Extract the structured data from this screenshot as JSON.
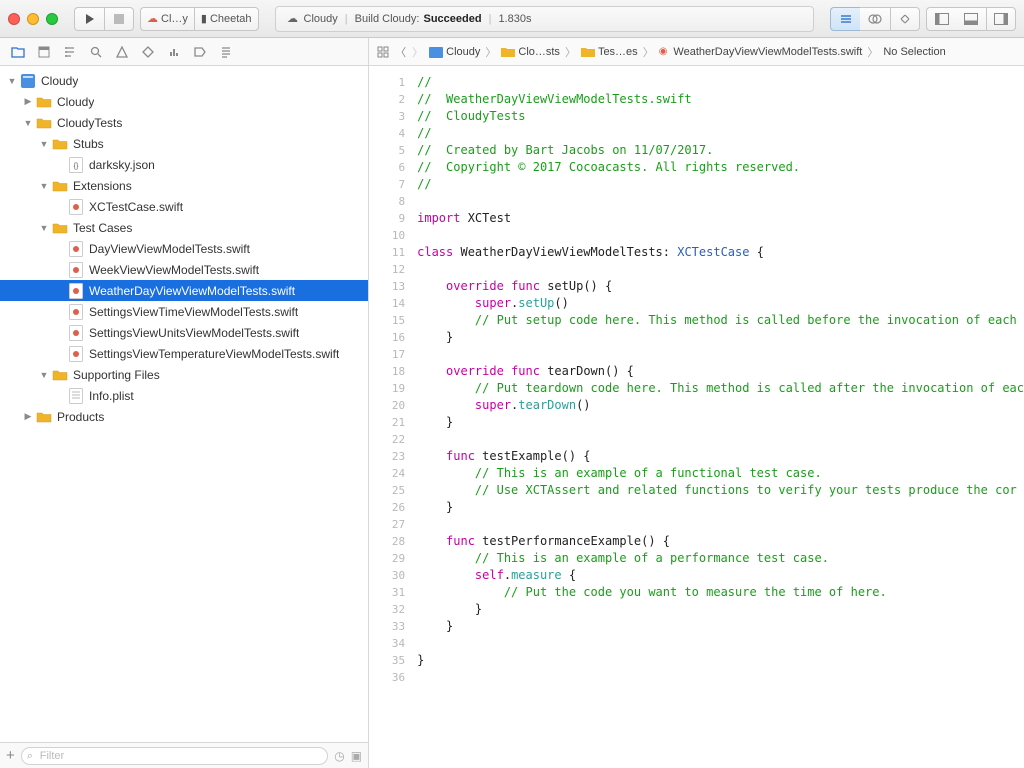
{
  "toolbar": {
    "scheme": "Cl…y",
    "device": "Cheetah",
    "status_app": "Cloudy",
    "status_action": "Build Cloudy:",
    "status_result": "Succeeded",
    "status_time": "1.830s"
  },
  "jumpbar": {
    "crumb1": "Cloudy",
    "crumb2": "Clo…sts",
    "crumb3": "Tes…es",
    "crumb4": "WeatherDayViewViewModelTests.swift",
    "crumb5": "No Selection"
  },
  "tree": [
    {
      "d": 0,
      "disc": "down",
      "icon": "proj",
      "label": "Cloudy"
    },
    {
      "d": 1,
      "disc": "right",
      "icon": "folder",
      "label": "Cloudy"
    },
    {
      "d": 1,
      "disc": "down",
      "icon": "folder",
      "label": "CloudyTests"
    },
    {
      "d": 2,
      "disc": "down",
      "icon": "folder",
      "label": "Stubs"
    },
    {
      "d": 3,
      "disc": "",
      "icon": "json",
      "label": "darksky.json"
    },
    {
      "d": 2,
      "disc": "down",
      "icon": "folder",
      "label": "Extensions"
    },
    {
      "d": 3,
      "disc": "",
      "icon": "swift",
      "label": "XCTestCase.swift"
    },
    {
      "d": 2,
      "disc": "down",
      "icon": "folder",
      "label": "Test Cases"
    },
    {
      "d": 3,
      "disc": "",
      "icon": "swift",
      "label": "DayViewViewModelTests.swift"
    },
    {
      "d": 3,
      "disc": "",
      "icon": "swift",
      "label": "WeekViewViewModelTests.swift"
    },
    {
      "d": 3,
      "disc": "",
      "icon": "swift",
      "label": "WeatherDayViewViewModelTests.swift",
      "sel": true
    },
    {
      "d": 3,
      "disc": "",
      "icon": "swift",
      "label": "SettingsViewTimeViewModelTests.swift"
    },
    {
      "d": 3,
      "disc": "",
      "icon": "swift",
      "label": "SettingsViewUnitsViewModelTests.swift"
    },
    {
      "d": 3,
      "disc": "",
      "icon": "swift",
      "label": "SettingsViewTemperatureViewModelTests.swift"
    },
    {
      "d": 2,
      "disc": "down",
      "icon": "folder",
      "label": "Supporting Files"
    },
    {
      "d": 3,
      "disc": "",
      "icon": "plist",
      "label": "Info.plist"
    },
    {
      "d": 1,
      "disc": "right",
      "icon": "folder",
      "label": "Products"
    }
  ],
  "filter_placeholder": "Filter",
  "code": {
    "lines": [
      {
        "n": 1,
        "seg": [
          [
            "//",
            "c"
          ]
        ]
      },
      {
        "n": 2,
        "seg": [
          [
            "//  WeatherDayViewViewModelTests.swift",
            "c"
          ]
        ]
      },
      {
        "n": 3,
        "seg": [
          [
            "//  CloudyTests",
            "c"
          ]
        ]
      },
      {
        "n": 4,
        "seg": [
          [
            "//",
            "c"
          ]
        ]
      },
      {
        "n": 5,
        "seg": [
          [
            "//  Created by Bart Jacobs on 11/07/2017.",
            "c"
          ]
        ]
      },
      {
        "n": 6,
        "seg": [
          [
            "//  Copyright © 2017 Cocoacasts. All rights reserved.",
            "c"
          ]
        ]
      },
      {
        "n": 7,
        "seg": [
          [
            "//",
            "c"
          ]
        ]
      },
      {
        "n": 8,
        "seg": [
          [
            "",
            ""
          ]
        ]
      },
      {
        "n": 9,
        "seg": [
          [
            "import",
            "kw"
          ],
          [
            " XCTest",
            ""
          ]
        ]
      },
      {
        "n": 10,
        "seg": [
          [
            "",
            ""
          ]
        ]
      },
      {
        "n": 11,
        "marker": true,
        "seg": [
          [
            "class",
            "kw"
          ],
          [
            " WeatherDayViewViewModelTests: ",
            ""
          ],
          [
            "XCTestCase",
            "type"
          ],
          [
            " {",
            ""
          ]
        ]
      },
      {
        "n": 12,
        "seg": [
          [
            "",
            ""
          ]
        ]
      },
      {
        "n": 13,
        "marker": true,
        "seg": [
          [
            "    ",
            ""
          ],
          [
            "override",
            "kw"
          ],
          [
            " ",
            ""
          ],
          [
            "func",
            "kw"
          ],
          [
            " setUp() {",
            ""
          ]
        ]
      },
      {
        "n": 14,
        "seg": [
          [
            "        ",
            ""
          ],
          [
            "super",
            "kw"
          ],
          [
            ".",
            ""
          ],
          [
            "setUp",
            "call"
          ],
          [
            "()",
            ""
          ]
        ]
      },
      {
        "n": 15,
        "seg": [
          [
            "        ",
            ""
          ],
          [
            "// Put setup code here. This method is called before the invocation of each",
            "c"
          ]
        ]
      },
      {
        "n": 16,
        "seg": [
          [
            "    }",
            ""
          ]
        ]
      },
      {
        "n": 17,
        "seg": [
          [
            "",
            ""
          ]
        ]
      },
      {
        "n": 18,
        "marker": true,
        "seg": [
          [
            "    ",
            ""
          ],
          [
            "override",
            "kw"
          ],
          [
            " ",
            ""
          ],
          [
            "func",
            "kw"
          ],
          [
            " tearDown() {",
            ""
          ]
        ]
      },
      {
        "n": 19,
        "seg": [
          [
            "        ",
            ""
          ],
          [
            "// Put teardown code here. This method is called after the invocation of eac",
            "c"
          ]
        ]
      },
      {
        "n": 20,
        "seg": [
          [
            "        ",
            ""
          ],
          [
            "super",
            "kw"
          ],
          [
            ".",
            ""
          ],
          [
            "tearDown",
            "call"
          ],
          [
            "()",
            ""
          ]
        ]
      },
      {
        "n": 21,
        "seg": [
          [
            "    }",
            ""
          ]
        ]
      },
      {
        "n": 22,
        "seg": [
          [
            "",
            ""
          ]
        ]
      },
      {
        "n": 23,
        "marker": true,
        "seg": [
          [
            "    ",
            ""
          ],
          [
            "func",
            "kw"
          ],
          [
            " testExample() {",
            ""
          ]
        ]
      },
      {
        "n": 24,
        "seg": [
          [
            "        ",
            ""
          ],
          [
            "// This is an example of a functional test case.",
            "c"
          ]
        ]
      },
      {
        "n": 25,
        "seg": [
          [
            "        ",
            ""
          ],
          [
            "// Use XCTAssert and related functions to verify your tests produce the cor",
            "c"
          ]
        ]
      },
      {
        "n": 26,
        "seg": [
          [
            "    }",
            ""
          ]
        ]
      },
      {
        "n": 27,
        "seg": [
          [
            "",
            ""
          ]
        ]
      },
      {
        "n": 28,
        "marker": true,
        "seg": [
          [
            "    ",
            ""
          ],
          [
            "func",
            "kw"
          ],
          [
            " testPerformanceExample() {",
            ""
          ]
        ]
      },
      {
        "n": 29,
        "seg": [
          [
            "        ",
            ""
          ],
          [
            "// This is an example of a performance test case.",
            "c"
          ]
        ]
      },
      {
        "n": 30,
        "seg": [
          [
            "        ",
            ""
          ],
          [
            "self",
            "kw"
          ],
          [
            ".",
            ""
          ],
          [
            "measure",
            "call"
          ],
          [
            " {",
            ""
          ]
        ]
      },
      {
        "n": 31,
        "seg": [
          [
            "            ",
            ""
          ],
          [
            "// Put the code you want to measure the time of here.",
            "c"
          ]
        ]
      },
      {
        "n": 32,
        "seg": [
          [
            "        }",
            ""
          ]
        ]
      },
      {
        "n": 33,
        "seg": [
          [
            "    }",
            ""
          ]
        ]
      },
      {
        "n": 34,
        "seg": [
          [
            "",
            ""
          ]
        ]
      },
      {
        "n": 35,
        "seg": [
          [
            "}",
            ""
          ]
        ]
      },
      {
        "n": 36,
        "seg": [
          [
            "",
            ""
          ]
        ]
      }
    ]
  }
}
